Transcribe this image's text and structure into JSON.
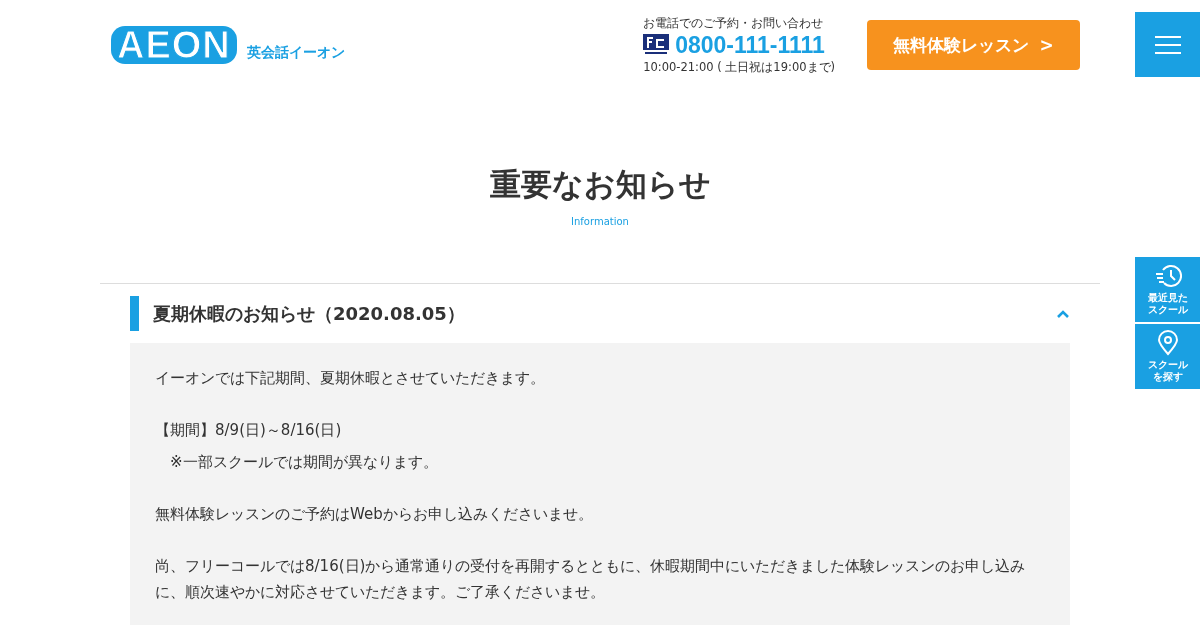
{
  "header": {
    "logo": "AEON",
    "logo_subtitle": "英会話イーオン",
    "phone_label": "お電話でのご予約・お問い合わせ",
    "phone_number": "0800-111-1111",
    "phone_hours": "10:00-21:00 ( 土日祝は19:00まで)",
    "trial_button": "無料体験レッスン",
    "trial_button_arrow": ">"
  },
  "page_title": "重要なお知らせ",
  "page_subtitle": "Information",
  "notices": [
    {
      "title": "夏期休暇のお知らせ（2020.08.05）",
      "expanded": true,
      "paragraphs": [
        {
          "lines": [
            "イーオンでは下記期間、夏期休暇とさせていただきます。"
          ]
        },
        {
          "lines": [
            "【期間】8/9(日)～8/16(日)",
            "　※一部スクールでは期間が異なります。"
          ]
        },
        {
          "lines": [
            "無料体験レッスンのご予約はWebからお申し込みくださいませ。"
          ]
        },
        {
          "lines": [
            "尚、フリーコールでは8/16(日)から通常通りの受付を再開するとともに、休暇期間中にいただきました体験レッスンのお申し込みに、順次速やかに対応させていただきます。ご了承くださいませ。"
          ]
        }
      ]
    }
  ],
  "side_buttons": [
    {
      "kind": "history",
      "label": [
        "最近見た",
        "スクール"
      ]
    },
    {
      "kind": "pin",
      "label": [
        "スクール",
        "を探す"
      ]
    }
  ]
}
